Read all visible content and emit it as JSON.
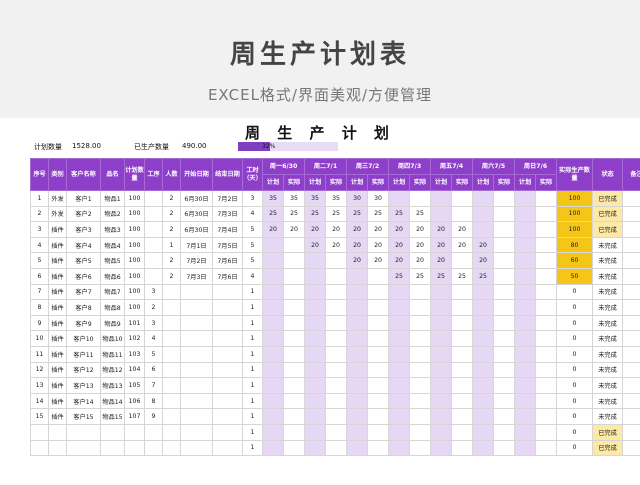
{
  "banner": {
    "title": "周生产计划表",
    "subtitle": "EXCEL格式/界面美观/方便管理"
  },
  "sheet": {
    "title": "周 生 产 计 划",
    "plan_qty_label": "计划数量",
    "plan_qty_value": "1528.00",
    "done_qty_label": "已生产数量",
    "done_qty_value": "490.00",
    "progress_percent": 32,
    "progress_text": "32%"
  },
  "headers": {
    "seq": "序号",
    "category": "类别",
    "customer": "客户名称",
    "product": "品名",
    "plan_qty": "计划数量",
    "process": "工序",
    "people": "人数",
    "start": "开始日期",
    "end": "结束日期",
    "hours": "工时（天）",
    "days": [
      "周一6/30",
      "周二7/1",
      "周三7/2",
      "周四7/3",
      "周五7/4",
      "周六7/5",
      "周日7/6"
    ],
    "plan": "计划",
    "actual": "实际",
    "produced": "实际生产数量",
    "status": "状态",
    "note": "备注"
  },
  "rows": [
    {
      "seq": "1",
      "category": "外发",
      "customer": "客户1",
      "product": "物品1",
      "plan_qty": "100",
      "process": "",
      "people": "2",
      "start": "6月30日",
      "end": "7月2日",
      "hours": "3",
      "d": [
        "35",
        "35",
        "35",
        "35",
        "30",
        "30",
        "",
        "",
        "",
        "",
        "",
        "",
        "",
        ""
      ],
      "produced": "100",
      "status": "已完成",
      "note": ""
    },
    {
      "seq": "2",
      "category": "外发",
      "customer": "客户2",
      "product": "物品2",
      "plan_qty": "100",
      "process": "",
      "people": "2",
      "start": "6月30日",
      "end": "7月3日",
      "hours": "4",
      "d": [
        "25",
        "25",
        "25",
        "25",
        "25",
        "25",
        "25",
        "25",
        "",
        "",
        "",
        "",
        "",
        ""
      ],
      "produced": "100",
      "status": "已完成",
      "note": ""
    },
    {
      "seq": "3",
      "category": "插件",
      "customer": "客户3",
      "product": "物品3",
      "plan_qty": "100",
      "process": "",
      "people": "2",
      "start": "6月30日",
      "end": "7月4日",
      "hours": "5",
      "d": [
        "20",
        "20",
        "20",
        "20",
        "20",
        "20",
        "20",
        "20",
        "20",
        "20",
        "",
        "",
        "",
        ""
      ],
      "produced": "100",
      "status": "已完成",
      "note": ""
    },
    {
      "seq": "4",
      "category": "插件",
      "customer": "客户4",
      "product": "物品4",
      "plan_qty": "100",
      "process": "",
      "people": "1",
      "start": "7月1日",
      "end": "7月5日",
      "hours": "5",
      "d": [
        "",
        "",
        "20",
        "20",
        "20",
        "20",
        "20",
        "20",
        "20",
        "20",
        "20",
        "",
        "",
        ""
      ],
      "produced": "80",
      "status": "未完成",
      "note": ""
    },
    {
      "seq": "5",
      "category": "插件",
      "customer": "客户5",
      "product": "物品5",
      "plan_qty": "100",
      "process": "",
      "people": "2",
      "start": "7月2日",
      "end": "7月6日",
      "hours": "5",
      "d": [
        "",
        "",
        "",
        "",
        "20",
        "20",
        "20",
        "20",
        "20",
        "",
        "20",
        "",
        "",
        ""
      ],
      "produced": "60",
      "status": "未完成",
      "note": ""
    },
    {
      "seq": "6",
      "category": "插件",
      "customer": "客户6",
      "product": "物品6",
      "plan_qty": "100",
      "process": "",
      "people": "2",
      "start": "7月3日",
      "end": "7月6日",
      "hours": "4",
      "d": [
        "",
        "",
        "",
        "",
        "",
        "",
        "25",
        "25",
        "25",
        "25",
        "25",
        "",
        "",
        ""
      ],
      "produced": "50",
      "status": "未完成",
      "note": ""
    },
    {
      "seq": "7",
      "category": "插件",
      "customer": "客户7",
      "product": "物品7",
      "plan_qty": "100",
      "process": "3",
      "people": "",
      "start": "",
      "end": "",
      "hours": "1",
      "d": [
        "",
        "",
        "",
        "",
        "",
        "",
        "",
        "",
        "",
        "",
        "",
        "",
        "",
        ""
      ],
      "produced": "0",
      "status": "未完成",
      "note": ""
    },
    {
      "seq": "8",
      "category": "插件",
      "customer": "客户8",
      "product": "物品8",
      "plan_qty": "100",
      "process": "2",
      "people": "",
      "start": "",
      "end": "",
      "hours": "1",
      "d": [
        "",
        "",
        "",
        "",
        "",
        "",
        "",
        "",
        "",
        "",
        "",
        "",
        "",
        ""
      ],
      "produced": "0",
      "status": "未完成",
      "note": ""
    },
    {
      "seq": "9",
      "category": "插件",
      "customer": "客户9",
      "product": "物品9",
      "plan_qty": "101",
      "process": "3",
      "people": "",
      "start": "",
      "end": "",
      "hours": "1",
      "d": [
        "",
        "",
        "",
        "",
        "",
        "",
        "",
        "",
        "",
        "",
        "",
        "",
        "",
        ""
      ],
      "produced": "0",
      "status": "未完成",
      "note": ""
    },
    {
      "seq": "10",
      "category": "插件",
      "customer": "客户10",
      "product": "物品10",
      "plan_qty": "102",
      "process": "4",
      "people": "",
      "start": "",
      "end": "",
      "hours": "1",
      "d": [
        "",
        "",
        "",
        "",
        "",
        "",
        "",
        "",
        "",
        "",
        "",
        "",
        "",
        ""
      ],
      "produced": "0",
      "status": "未完成",
      "note": ""
    },
    {
      "seq": "11",
      "category": "插件",
      "customer": "客户11",
      "product": "物品11",
      "plan_qty": "103",
      "process": "5",
      "people": "",
      "start": "",
      "end": "",
      "hours": "1",
      "d": [
        "",
        "",
        "",
        "",
        "",
        "",
        "",
        "",
        "",
        "",
        "",
        "",
        "",
        ""
      ],
      "produced": "0",
      "status": "未完成",
      "note": ""
    },
    {
      "seq": "12",
      "category": "插件",
      "customer": "客户12",
      "product": "物品12",
      "plan_qty": "104",
      "process": "6",
      "people": "",
      "start": "",
      "end": "",
      "hours": "1",
      "d": [
        "",
        "",
        "",
        "",
        "",
        "",
        "",
        "",
        "",
        "",
        "",
        "",
        "",
        ""
      ],
      "produced": "0",
      "status": "未完成",
      "note": ""
    },
    {
      "seq": "13",
      "category": "插件",
      "customer": "客户13",
      "product": "物品13",
      "plan_qty": "105",
      "process": "7",
      "people": "",
      "start": "",
      "end": "",
      "hours": "1",
      "d": [
        "",
        "",
        "",
        "",
        "",
        "",
        "",
        "",
        "",
        "",
        "",
        "",
        "",
        ""
      ],
      "produced": "0",
      "status": "未完成",
      "note": ""
    },
    {
      "seq": "14",
      "category": "插件",
      "customer": "客户14",
      "product": "物品14",
      "plan_qty": "106",
      "process": "8",
      "people": "",
      "start": "",
      "end": "",
      "hours": "1",
      "d": [
        "",
        "",
        "",
        "",
        "",
        "",
        "",
        "",
        "",
        "",
        "",
        "",
        "",
        ""
      ],
      "produced": "0",
      "status": "未完成",
      "note": ""
    },
    {
      "seq": "15",
      "category": "插件",
      "customer": "客户15",
      "product": "物品15",
      "plan_qty": "107",
      "process": "9",
      "people": "",
      "start": "",
      "end": "",
      "hours": "1",
      "d": [
        "",
        "",
        "",
        "",
        "",
        "",
        "",
        "",
        "",
        "",
        "",
        "",
        "",
        ""
      ],
      "produced": "0",
      "status": "未完成",
      "note": ""
    },
    {
      "seq": "",
      "category": "",
      "customer": "",
      "product": "",
      "plan_qty": "",
      "process": "",
      "people": "",
      "start": "",
      "end": "",
      "hours": "1",
      "d": [
        "",
        "",
        "",
        "",
        "",
        "",
        "",
        "",
        "",
        "",
        "",
        "",
        "",
        ""
      ],
      "produced": "0",
      "status": "已完成",
      "note": ""
    },
    {
      "seq": "",
      "category": "",
      "customer": "",
      "product": "",
      "plan_qty": "",
      "process": "",
      "people": "",
      "start": "",
      "end": "",
      "hours": "1",
      "d": [
        "",
        "",
        "",
        "",
        "",
        "",
        "",
        "",
        "",
        "",
        "",
        "",
        "",
        ""
      ],
      "produced": "0",
      "status": "已完成",
      "note": ""
    }
  ],
  "colors": {
    "header": "#8e3fc9",
    "plan_column": "#e6d7f5",
    "qty_highlight": "#f5c518",
    "done_status": "#fde9a6"
  }
}
